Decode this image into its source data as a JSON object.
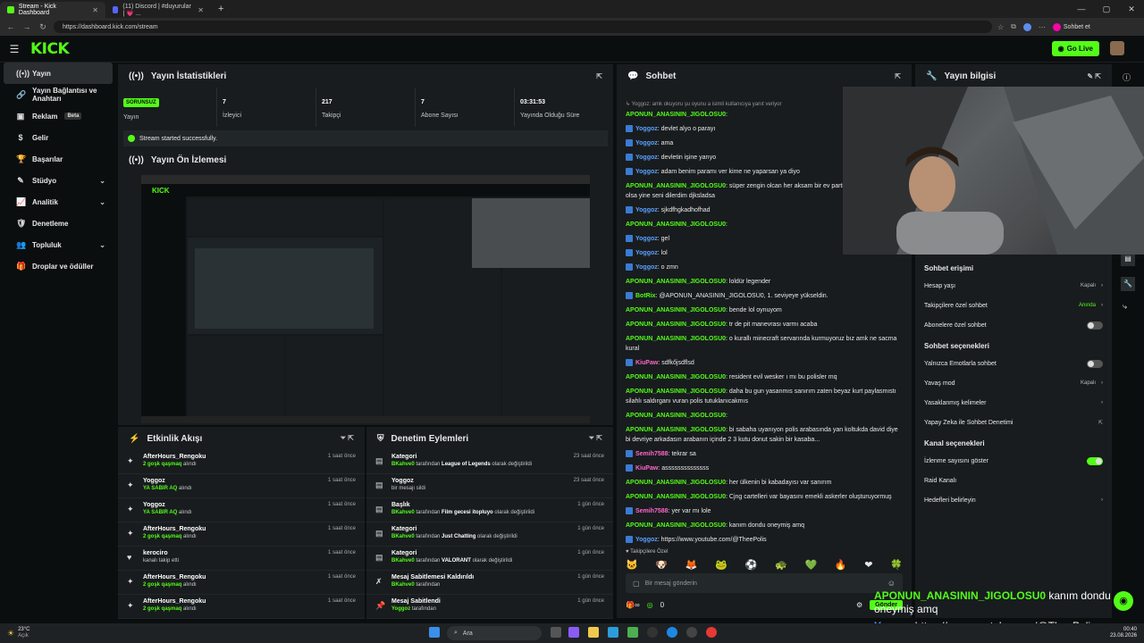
{
  "browser": {
    "tabs": [
      {
        "label": "Stream - Kick Dashboard",
        "close": "✕"
      },
      {
        "label": "(11) Discord | #duyurular | 💗 ...",
        "close": "✕"
      }
    ],
    "new_tab": "+",
    "url": "https://dashboard.kick.com/stream",
    "sohbet_label": "Sohbet et",
    "window_controls": [
      "—",
      "▢",
      "✕"
    ]
  },
  "header": {
    "logo": "KICK",
    "go_live": "Go Live"
  },
  "sidebar": {
    "items": [
      {
        "label": "Yayın",
        "icon": "((•))",
        "active": true
      },
      {
        "label": "Yayın Bağlantısı ve Anahtarı",
        "icon": "🔗"
      },
      {
        "label": "Reklam",
        "icon": "▣",
        "badge": "Beta"
      },
      {
        "label": "Gelir",
        "icon": "$"
      },
      {
        "label": "Başarılar",
        "icon": "🏆"
      },
      {
        "label": "Stüdyo",
        "icon": "✎",
        "chevron": "⌄"
      },
      {
        "label": "Analitik",
        "icon": "📈",
        "chevron": "⌄"
      },
      {
        "label": "Denetleme",
        "icon": "🛡"
      },
      {
        "label": "Topluluk",
        "icon": "👥",
        "chevron": "⌄"
      },
      {
        "label": "Droplar ve ödüller",
        "icon": "🎁"
      }
    ]
  },
  "stats_panel": {
    "title": "Yayın İstatistikleri",
    "status_badge": "SORUNSUZ",
    "items": [
      {
        "value": "",
        "label": "Yayın"
      },
      {
        "value": "7",
        "label": "İzleyici"
      },
      {
        "value": "217",
        "label": "Takipçi"
      },
      {
        "value": "7",
        "label": "Abone Sayısı"
      },
      {
        "value": "03:31:53",
        "label": "Yayında Olduğu Süre"
      }
    ],
    "success": "Stream started successfully."
  },
  "preview_panel": {
    "title": "Yayın Ön İzlemesi"
  },
  "activity": {
    "title": "Etkinlik Akışı",
    "rows": [
      {
        "name": "AfterHours_Rengoku",
        "highlight": "2 goşk qaşmaq",
        "rest": " alındı",
        "time": "1 saat önce",
        "icon": "✦"
      },
      {
        "name": "Yoggoz",
        "highlight": "YA SABIR AQ",
        "rest": " alındı",
        "time": "1 saat önce",
        "icon": "✦"
      },
      {
        "name": "Yoggoz",
        "highlight": "YA SABIR AQ",
        "rest": " alındı",
        "time": "1 saat önce",
        "icon": "✦"
      },
      {
        "name": "AfterHours_Rengoku",
        "highlight": "2 goşk qaşmaq",
        "rest": " alındı",
        "time": "1 saat önce",
        "icon": "✦"
      },
      {
        "name": "kerociro",
        "highlight": "",
        "rest": "kanalı takip etti",
        "time": "1 saat önce",
        "icon": "♥"
      },
      {
        "name": "AfterHours_Rengoku",
        "highlight": "2 goşk qaşmaq",
        "rest": " alındı",
        "time": "1 saat önce",
        "icon": "✦"
      },
      {
        "name": "AfterHours_Rengoku",
        "highlight": "2 goşk qaşmaq",
        "rest": " alındı",
        "time": "1 saat önce",
        "icon": "✦"
      }
    ]
  },
  "moderation": {
    "title": "Denetim Eylemleri",
    "rows": [
      {
        "name": "Kategori",
        "highlight": "BKahve0",
        "rest": " tarafından ",
        "highlight2": "League of Legends",
        "rest2": " olarak değiştirildi",
        "time": "23 saat önce",
        "icon": "▤"
      },
      {
        "name": "Yoggoz",
        "highlight": "",
        "rest": "bir mesajı sildi",
        "highlight2": "",
        "rest2": "",
        "time": "23 saat önce",
        "icon": "▤"
      },
      {
        "name": "Başlık",
        "highlight": "BKahve0",
        "rest": " tarafından ",
        "highlight2": "Film gecesi itopluyo",
        "rest2": " olarak değiştirildi",
        "time": "1 gün önce",
        "icon": "▤"
      },
      {
        "name": "Kategori",
        "highlight": "BKahve0",
        "rest": " tarafından ",
        "highlight2": "Just Chatting",
        "rest2": " olarak değiştirildi",
        "time": "1 gün önce",
        "icon": "▤"
      },
      {
        "name": "Kategori",
        "highlight": "BKahve0",
        "rest": " tarafından ",
        "highlight2": "VALORANT",
        "rest2": " olarak değiştirildi",
        "time": "1 gün önce",
        "icon": "▤"
      },
      {
        "name": "Mesaj Sabitlemesi Kaldırıldı",
        "highlight": "BKahve0",
        "rest": " tarafından",
        "highlight2": "",
        "rest2": "",
        "time": "1 gün önce",
        "icon": "✗"
      },
      {
        "name": "Mesaj Sabitlendi",
        "highlight": "Yoggoz",
        "rest": " tarafından",
        "highlight2": "",
        "rest2": "",
        "time": "1 gün önce",
        "icon": "📌"
      }
    ]
  },
  "chat": {
    "title": "Sohbet",
    "reply": "↳ Yoggoz: amk okuyoru şu oyunu a isimli kullanıcıya yanıt veriyor",
    "messages": [
      {
        "user": "APONUN_ANASININ_JIGOLOSU0",
        "text": "",
        "c": "u",
        "b": false
      },
      {
        "user": "Yoggoz",
        "text": "devlet alyo o parayı",
        "c": "u2",
        "b": true
      },
      {
        "user": "Yoggoz",
        "text": "ama",
        "c": "u2",
        "b": true
      },
      {
        "user": "Yoggoz",
        "text": "devletin işine yarıyo",
        "c": "u2",
        "b": true
      },
      {
        "user": "Yoggoz",
        "text": "adam benim paramı ver kime ne yaparsan ya diyo",
        "c": "u2",
        "b": true
      },
      {
        "user": "APONUN_ANASININ_JIGOLOSU0",
        "text": "süper zengin olcan her aksam bir ev partisi verecem hakkım olsa yine seni dilerdim djksladsa",
        "c": "u",
        "b": false
      },
      {
        "user": "Yoggoz",
        "text": "sjkdfhgkadhofhad",
        "c": "u2",
        "b": true
      },
      {
        "user": "APONUN_ANASININ_JIGOLOSU0",
        "text": "",
        "c": "u",
        "b": false
      },
      {
        "user": "Yoggoz",
        "text": "gel",
        "c": "u2",
        "b": true
      },
      {
        "user": "Yoggoz",
        "text": "lol",
        "c": "u2",
        "b": true
      },
      {
        "user": "Yoggoz",
        "text": "o zmn",
        "c": "u2",
        "b": true
      },
      {
        "user": "APONUN_ANASININ_JIGOLOSU0",
        "text": "loldür legender",
        "c": "u",
        "b": false
      },
      {
        "user": "BotRix",
        "text": "@APONUN_ANASININ_JIGOLOSU0, 1. seviyeye yükseldin.",
        "c": "u",
        "b": true
      },
      {
        "user": "APONUN_ANASININ_JIGOLOSU0",
        "text": "bende lol oynuyom",
        "c": "u",
        "b": false
      },
      {
        "user": "APONUN_ANASININ_JIGOLOSU0",
        "text": "tr de pit manevrası varmı acaba",
        "c": "u",
        "b": false
      },
      {
        "user": "APONUN_ANASININ_JIGOLOSU0",
        "text": "o kurallı minecraft servarında kurmuyoruz bız amk ne sacma kural",
        "c": "u",
        "b": false
      },
      {
        "user": "KiuPaw",
        "text": "sdfkőjsdflsd",
        "c": "u3",
        "b": true
      },
      {
        "user": "APONUN_ANASININ_JIGOLOSU0",
        "text": "resident evil wesker ı mı bu polisler mq",
        "c": "u",
        "b": false
      },
      {
        "user": "APONUN_ANASININ_JIGOLOSU0",
        "text": "daha bu gun yasanmıs sanırım zaten beyaz kurt paylasmıstı silahlı saldırganı vuran polis tutuklanıcakmıs",
        "c": "u",
        "b": false
      },
      {
        "user": "APONUN_ANASININ_JIGOLOSU0",
        "text": "",
        "c": "u",
        "b": false
      },
      {
        "user": "APONUN_ANASININ_JIGOLOSU0",
        "text": "bi sabaha uyanıyon polis arabasında yan koltukda david diye bi devriye arkadasın arabanın içinde 2 3 kutu donut sakin bir kasaba...",
        "c": "u",
        "b": false
      },
      {
        "user": "Semih7588",
        "text": "tekrar sa",
        "c": "u3",
        "b": true
      },
      {
        "user": "KiuPaw",
        "text": "assssssssssssss",
        "c": "u3",
        "b": true
      },
      {
        "user": "APONUN_ANASININ_JIGOLOSU0",
        "text": "her ülkenin bi kabadayısı var sanırım",
        "c": "u",
        "b": false
      },
      {
        "user": "APONUN_ANASININ_JIGOLOSU0",
        "text": "Cjng cartelleri var bayasını emekli askerler oluşturuyormuş",
        "c": "u",
        "b": false
      },
      {
        "user": "Semih7588",
        "text": "yer var mı lole",
        "c": "u3",
        "b": true
      },
      {
        "user": "APONUN_ANASININ_JIGOLOSU0",
        "text": "kanım dondu oneymiş amq",
        "c": "u",
        "b": false
      },
      {
        "user": "Yoggoz",
        "text": "https://www.youtube.com/@TheePolis",
        "c": "u2",
        "b": true
      }
    ],
    "followers_only": "♥ Takipçilere Özel",
    "input_placeholder": "Bir mesaj gönderin",
    "send": "Gönder",
    "count": "0"
  },
  "stream_info": {
    "title": "Yayın bilgisi",
    "sections": [
      {
        "heading": "Sohbet erişimi",
        "rows": [
          {
            "label": "Hesap yaşı",
            "value": "Kapalı",
            "type": "chev"
          },
          {
            "label": "Takipçilere özel sohbet",
            "value": "Anında",
            "type": "chev",
            "green": true
          },
          {
            "label": "Abonelere özel sohbet",
            "value": "",
            "type": "toggle"
          }
        ]
      },
      {
        "heading": "Sohbet seçenekleri",
        "rows": [
          {
            "label": "Yalnızca Emotlarla sohbet",
            "value": "",
            "type": "toggle"
          },
          {
            "label": "Yavaş mod",
            "value": "Kapalı",
            "type": "chev"
          },
          {
            "label": "Yasaklanmış kelimeler",
            "value": "",
            "type": "chev"
          },
          {
            "label": "Yapay Zeka ile Sohbet Denetimi",
            "value": "",
            "type": "ext"
          }
        ]
      },
      {
        "heading": "Kanal seçenekleri",
        "rows": [
          {
            "label": "İzlenme sayısını göster",
            "value": "",
            "type": "toggle-on"
          },
          {
            "label": "Raid Kanalı",
            "value": "",
            "type": "none"
          },
          {
            "label": "Hedefleri belirleyin",
            "value": "",
            "type": "chev"
          }
        ]
      }
    ]
  },
  "overlay": {
    "line1_user": "APONUN_ANASININ_JIGOLOSU0",
    "line1_text": " kanım dondu oneymiş amq",
    "line2_user": "Yoggoz",
    "line2_text": " https://www.youtube.com/@TheePolis"
  },
  "taskbar": {
    "weather_temp": "23°C",
    "weather_desc": "Açık",
    "search": "Ara",
    "time": "00:40",
    "date": "23.08.2026"
  }
}
